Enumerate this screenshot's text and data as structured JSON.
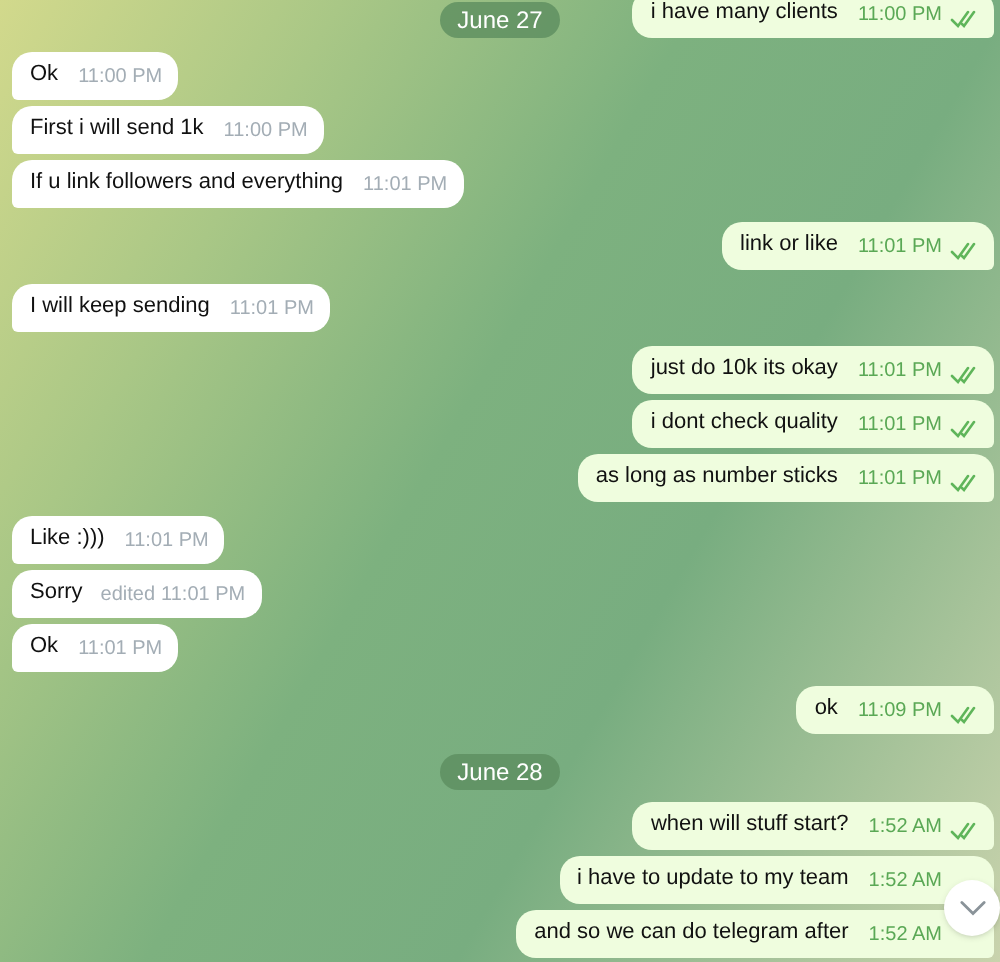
{
  "sticky_date": "June 27",
  "items": [
    {
      "kind": "message",
      "outgoing": true,
      "text": "i have many clients",
      "time": "11:00 PM",
      "read": true
    },
    {
      "kind": "message",
      "outgoing": false,
      "text": "Ok",
      "time": "11:00 PM"
    },
    {
      "kind": "message",
      "outgoing": false,
      "text": "First i will send 1k",
      "time": "11:00 PM"
    },
    {
      "kind": "message",
      "outgoing": false,
      "text": "If u link followers and everything",
      "time": "11:01 PM"
    },
    {
      "kind": "message",
      "outgoing": true,
      "text": "link or like",
      "time": "11:01 PM",
      "read": true
    },
    {
      "kind": "message",
      "outgoing": false,
      "text": "I will keep sending",
      "time": "11:01 PM"
    },
    {
      "kind": "message",
      "outgoing": true,
      "text": "just do 10k its okay",
      "time": "11:01 PM",
      "read": true
    },
    {
      "kind": "message",
      "outgoing": true,
      "text": "i dont check quality",
      "time": "11:01 PM",
      "read": true
    },
    {
      "kind": "message",
      "outgoing": true,
      "text": "as long as number sticks",
      "time": "11:01 PM",
      "read": true
    },
    {
      "kind": "message",
      "outgoing": false,
      "text": "Like :)))",
      "time": "11:01 PM"
    },
    {
      "kind": "message",
      "outgoing": false,
      "text": "Sorry",
      "edited_label": "edited",
      "time": "11:01 PM"
    },
    {
      "kind": "message",
      "outgoing": false,
      "text": "Ok",
      "time": "11:01 PM"
    },
    {
      "kind": "message",
      "outgoing": true,
      "text": "ok",
      "time": "11:09 PM",
      "read": true
    },
    {
      "kind": "date",
      "text": "June 28"
    },
    {
      "kind": "message",
      "outgoing": true,
      "text": "when will stuff start?",
      "time": "1:52 AM",
      "read": true
    },
    {
      "kind": "message",
      "outgoing": true,
      "text": "i have to update to my team",
      "time": "1:52 AM"
    },
    {
      "kind": "message",
      "outgoing": true,
      "text": "and so we can do telegram after",
      "time": "1:52 AM"
    }
  ]
}
